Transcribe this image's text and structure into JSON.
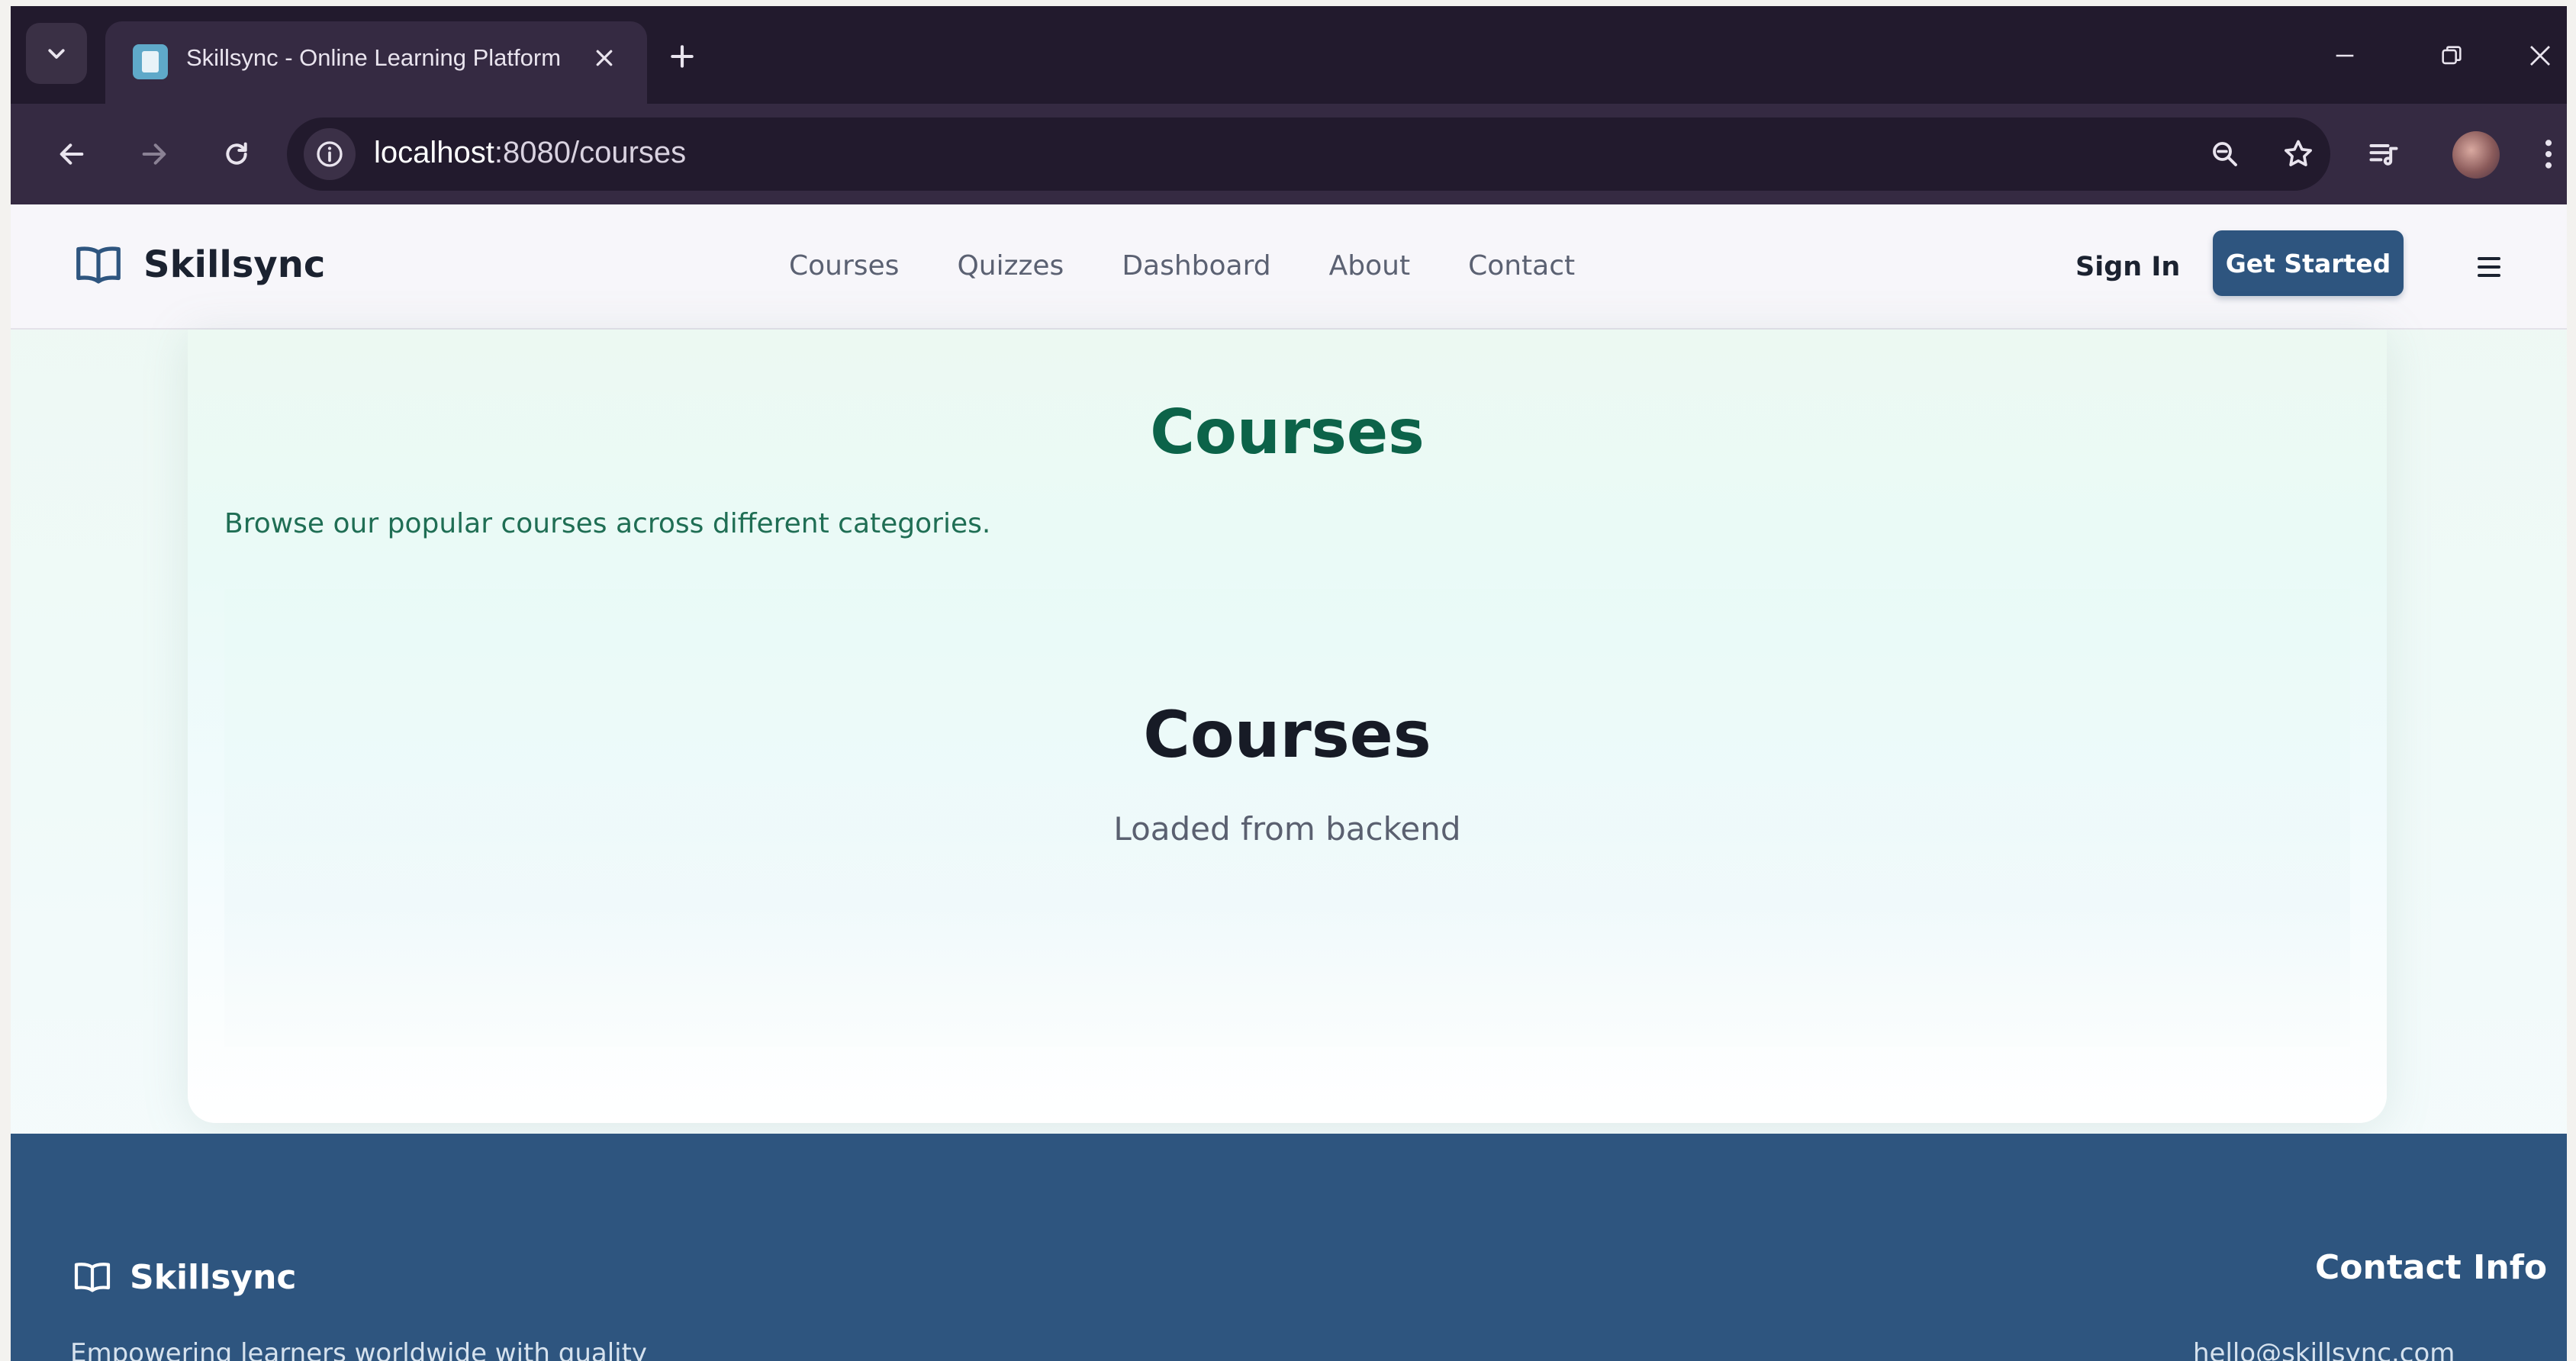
{
  "browser": {
    "tab_title": "Skillsync - Online Learning Platform",
    "url_host": "localhost",
    "url_rest": ":8080/courses"
  },
  "site": {
    "brand": "Skillsync",
    "nav": [
      "Courses",
      "Quizzes",
      "Dashboard",
      "About",
      "Contact"
    ],
    "signin_label": "Sign In",
    "cta_label": "Get Started"
  },
  "main": {
    "title": "Courses",
    "description": "Browse our popular courses across different categories.",
    "inner_title": "Courses",
    "inner_subtitle": "Loaded from backend"
  },
  "footer": {
    "brand": "Skillsync",
    "tagline": "Empowering learners worldwide with quality",
    "contact_title": "Contact Info",
    "contact_line": "hello@skillsync.com"
  },
  "colors": {
    "browser_frame": "#221a2d",
    "primary": "#2e557f",
    "heading_green": "#0c6349"
  },
  "icons": {
    "tab_search": "chevron-down-icon",
    "favicon": "document-icon",
    "close": "close-icon",
    "new_tab": "plus-icon",
    "back": "arrow-left-icon",
    "forward": "arrow-right-icon",
    "reload": "reload-icon",
    "site_info": "info-icon",
    "zoom": "zoom-icon",
    "bookmark": "star-icon",
    "media": "media-queue-icon",
    "menu": "kebab-menu-icon",
    "brand": "open-book-icon",
    "hamburger": "hamburger-icon"
  }
}
